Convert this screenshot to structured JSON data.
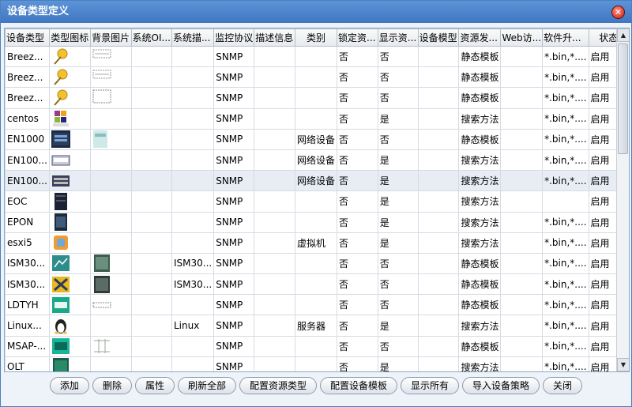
{
  "window": {
    "title": "设备类型定义",
    "close_glyph": "✕"
  },
  "table": {
    "columns": [
      "设备类型",
      "类型图标",
      "背景图片",
      "系统OI...",
      "系统描...",
      "监控协议",
      "描述信息",
      "类别",
      "锁定资...",
      "显示资...",
      "设备模型",
      "资源发...",
      "Web访...",
      "软件升...",
      "状态"
    ],
    "rows": [
      {
        "type": "Breez...",
        "icon": "pushpin-icon",
        "bg": "device-panel-a",
        "oid": "",
        "desc_sys": "",
        "protocol": "SNMP",
        "desc": "",
        "category": "",
        "lock": "否",
        "show": "否",
        "model": "",
        "discovery": "静态模板",
        "web": "",
        "upgrade": "*.bin,*....",
        "status": "启用"
      },
      {
        "type": "Breez...",
        "icon": "pushpin-icon",
        "bg": "device-panel-a",
        "oid": "",
        "desc_sys": "",
        "protocol": "SNMP",
        "desc": "",
        "category": "",
        "lock": "否",
        "show": "否",
        "model": "",
        "discovery": "静态模板",
        "web": "",
        "upgrade": "*.bin,*....",
        "status": "启用"
      },
      {
        "type": "Breez...",
        "icon": "pushpin-icon",
        "bg": "device-panel-b",
        "oid": "",
        "desc_sys": "",
        "protocol": "SNMP",
        "desc": "",
        "category": "",
        "lock": "否",
        "show": "否",
        "model": "",
        "discovery": "静态模板",
        "web": "",
        "upgrade": "*.bin,*....",
        "status": "启用"
      },
      {
        "type": "centos",
        "icon": "centos-logo-icon",
        "bg": "",
        "oid": "",
        "desc_sys": "",
        "protocol": "SNMP",
        "desc": "",
        "category": "",
        "lock": "否",
        "show": "是",
        "model": "",
        "discovery": "搜索方法",
        "web": "",
        "upgrade": "*.bin,*....",
        "status": "启用"
      },
      {
        "type": "EN1000",
        "icon": "network-device-icon",
        "bg": "device-panel-c",
        "oid": "",
        "desc_sys": "",
        "protocol": "SNMP",
        "desc": "",
        "category": "网络设备",
        "lock": "否",
        "show": "否",
        "model": "",
        "discovery": "静态模板",
        "web": "",
        "upgrade": "*.bin,*....",
        "status": "启用"
      },
      {
        "type": "EN100...",
        "icon": "switch-icon",
        "bg": "",
        "oid": "",
        "desc_sys": "",
        "protocol": "SNMP",
        "desc": "",
        "category": "网络设备",
        "lock": "否",
        "show": "是",
        "model": "",
        "discovery": "搜索方法",
        "web": "",
        "upgrade": "*.bin,*....",
        "status": "启用"
      },
      {
        "type": "EN100...",
        "icon": "router-icon",
        "bg": "",
        "oid": "",
        "desc_sys": "",
        "protocol": "SNMP",
        "desc": "",
        "category": "网络设备",
        "lock": "否",
        "show": "是",
        "model": "",
        "discovery": "搜索方法",
        "web": "",
        "upgrade": "*.bin,*....",
        "status": "启用"
      },
      {
        "type": "EOC",
        "icon": "eoc-device-icon",
        "bg": "",
        "oid": "",
        "desc_sys": "",
        "protocol": "SNMP",
        "desc": "",
        "category": "",
        "lock": "否",
        "show": "是",
        "model": "",
        "discovery": "搜索方法",
        "web": "",
        "upgrade": "",
        "status": "启用"
      },
      {
        "type": "EPON",
        "icon": "epon-device-icon",
        "bg": "",
        "oid": "",
        "desc_sys": "",
        "protocol": "SNMP",
        "desc": "",
        "category": "",
        "lock": "否",
        "show": "是",
        "model": "",
        "discovery": "搜索方法",
        "web": "",
        "upgrade": "*.bin,*....",
        "status": "启用"
      },
      {
        "type": "esxi5",
        "icon": "vmware-icon",
        "bg": "",
        "oid": "",
        "desc_sys": "",
        "protocol": "SNMP",
        "desc": "",
        "category": "虚拟机",
        "lock": "否",
        "show": "是",
        "model": "",
        "discovery": "搜索方法",
        "web": "",
        "upgrade": "*.bin,*....",
        "status": "启用"
      },
      {
        "type": "ISM30...",
        "icon": "ism-device-icon",
        "bg": "device-panel-d",
        "oid": "",
        "desc_sys": "ISM30...",
        "protocol": "SNMP",
        "desc": "",
        "category": "",
        "lock": "否",
        "show": "否",
        "model": "",
        "discovery": "静态模板",
        "web": "",
        "upgrade": "*.bin,*....",
        "status": "启用"
      },
      {
        "type": "ISM30...",
        "icon": "ism-cross-icon",
        "bg": "device-panel-e",
        "oid": "",
        "desc_sys": "ISM30...",
        "protocol": "SNMP",
        "desc": "",
        "category": "",
        "lock": "否",
        "show": "否",
        "model": "",
        "discovery": "静态模板",
        "web": "",
        "upgrade": "*.bin,*....",
        "status": "启用"
      },
      {
        "type": "LDTYH",
        "icon": "ldtyh-device-icon",
        "bg": "device-panel-f",
        "oid": "",
        "desc_sys": "",
        "protocol": "SNMP",
        "desc": "",
        "category": "",
        "lock": "否",
        "show": "否",
        "model": "",
        "discovery": "静态模板",
        "web": "",
        "upgrade": "*.bin,*....",
        "status": "启用"
      },
      {
        "type": "Linux...",
        "icon": "tux-icon",
        "bg": "",
        "oid": "",
        "desc_sys": "Linux",
        "protocol": "SNMP",
        "desc": "",
        "category": "服务器",
        "lock": "否",
        "show": "是",
        "model": "",
        "discovery": "搜索方法",
        "web": "",
        "upgrade": "*.bin,*....",
        "status": "启用"
      },
      {
        "type": "MSAP-...",
        "icon": "msap-device-icon",
        "bg": "device-panel-g",
        "oid": "",
        "desc_sys": "",
        "protocol": "SNMP",
        "desc": "",
        "category": "",
        "lock": "否",
        "show": "否",
        "model": "",
        "discovery": "静态模板",
        "web": "",
        "upgrade": "*.bin,*....",
        "status": "启用"
      },
      {
        "type": "OLT",
        "icon": "olt-device-icon",
        "bg": "",
        "oid": "",
        "desc_sys": "",
        "protocol": "SNMP",
        "desc": "",
        "category": "",
        "lock": "否",
        "show": "是",
        "model": "",
        "discovery": "搜索方法",
        "web": "",
        "upgrade": "*.bin,*....",
        "status": "启用"
      }
    ]
  },
  "buttons": [
    "添加",
    "删除",
    "属性",
    "刷新全部",
    "配置资源类型",
    "配置设备模板",
    "显示所有",
    "导入设备策略",
    "关闭"
  ],
  "colors": {
    "titlebar": "#4a82c8",
    "selected_row": "#e8edf5"
  }
}
